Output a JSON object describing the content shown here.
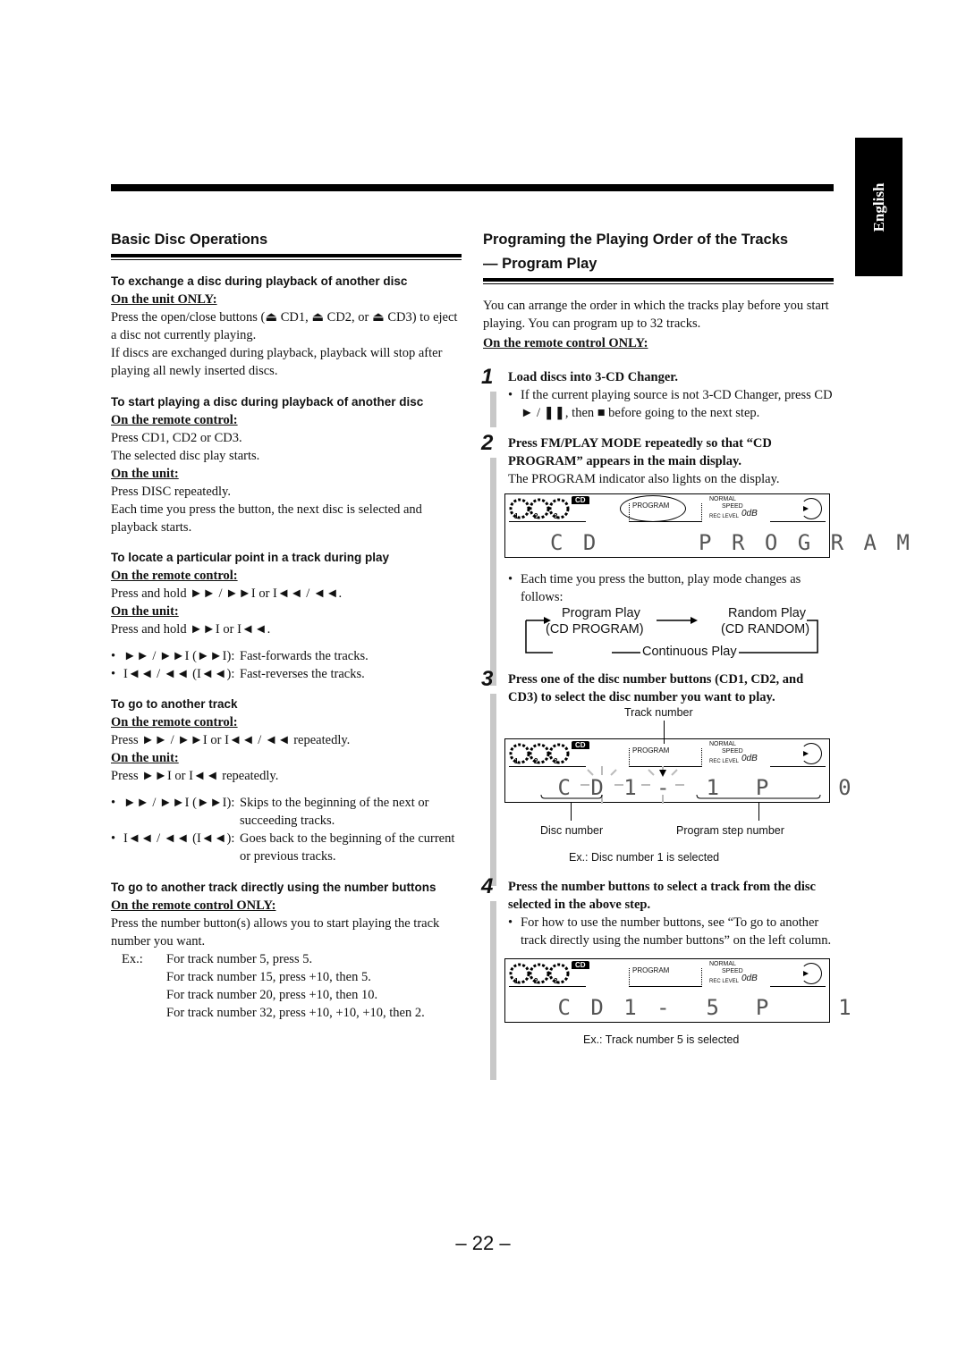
{
  "language_tab": "English",
  "page_number": "– 22 –",
  "left": {
    "title": "Basic Disc Operations",
    "exchange": {
      "heading": "To exchange a disc during playback of another disc",
      "where": "On the unit ONLY:",
      "p1": "Press the open/close buttons (⏏ CD1, ⏏ CD2, or ⏏ CD3) to eject a disc not currently playing.",
      "p2": "If discs are exchanged during playback, playback will stop after playing all newly inserted discs."
    },
    "start": {
      "heading": "To start playing a disc during playback of another disc",
      "remote_label": "On the remote control:",
      "remote_l1": "Press CD1, CD2 or CD3.",
      "remote_l2": "The selected disc play starts.",
      "unit_label": "On the unit:",
      "unit_l1": "Press DISC repeatedly.",
      "unit_l2": "Each time you press the button, the next disc is selected and playback starts."
    },
    "locate": {
      "heading": "To locate a particular point in a track during play",
      "remote_label": "On the remote control:",
      "remote_l1": "Press and hold ►► / ►►I or I◄◄ / ◄◄.",
      "unit_label": "On the unit:",
      "unit_l1": "Press and hold ►►I or I◄◄.",
      "bullets": [
        {
          "label": "►► / ►►I (►►I):",
          "text": "Fast-forwards the tracks."
        },
        {
          "label": "I◄◄ / ◄◄ (I◄◄):",
          "text": "Fast-reverses the tracks."
        }
      ]
    },
    "another": {
      "heading": "To go to another track",
      "remote_label": "On the remote control:",
      "remote_l1": "Press ►► / ►►I or I◄◄ / ◄◄ repeatedly.",
      "unit_label": "On the unit:",
      "unit_l1": "Press ►►I or I◄◄ repeatedly.",
      "bullets": [
        {
          "label": "►► / ►►I (►►I):",
          "text": "Skips to the beginning of the next or succeeding tracks."
        },
        {
          "label": "I◄◄ / ◄◄ (I◄◄):",
          "text": "Goes back to the beginning of the current or previous tracks."
        }
      ]
    },
    "direct": {
      "heading": "To go to another track directly using the number buttons",
      "where": "On the remote control ONLY:",
      "p1": "Press the number button(s) allows you to start playing the track number you want.",
      "ex_label": "Ex.:",
      "examples": [
        "For track number 5, press 5.",
        "For track number 15, press +10, then 5.",
        "For track number 20, press +10, then 10.",
        "For track number 32, press +10, +10, +10, then 2."
      ]
    }
  },
  "right": {
    "title_l1": "Programing the Playing Order of the Tracks",
    "title_l2": "— Program Play",
    "intro": "You can arrange the order in which the tracks play before you start playing. You can program up to 32 tracks.",
    "where": "On the remote control ONLY:",
    "steps": [
      {
        "num": "1",
        "title": "Load discs into 3-CD Changer.",
        "bullet": "If the current playing source is not 3-CD Changer, press CD ► / ❚❚, then ■ before going to the next step."
      },
      {
        "num": "2",
        "title": "Press FM/PLAY MODE repeatedly so that “CD PROGRAM” appears in the main display.",
        "body": "The PROGRAM indicator also lights on the display.",
        "bullet": "Each time you press the button, play mode changes as follows:",
        "mode_cycle": {
          "program_play": "Program Play",
          "program_sub": "(CD PROGRAM)",
          "random_play": "Random Play",
          "random_sub": "(CD RANDOM)",
          "continuous": "Continuous Play"
        }
      },
      {
        "num": "3",
        "title": "Press one of the disc number buttons (CD1, CD2, and CD3) to select the disc number you want to play.",
        "track_label": "Track number",
        "disc_label": "Disc number",
        "step_label": "Program step number",
        "caption": "Ex.: Disc number 1 is selected"
      },
      {
        "num": "4",
        "title": "Press the number buttons to select a track from the disc selected in the above step.",
        "bullet": "For how to use the number buttons, see “To go to another track directly using the number buttons” on the left column.",
        "caption": "Ex.: Track number 5 is selected"
      }
    ],
    "lcd": {
      "cd_badge": "CD",
      "disc_digits": "1 2 3",
      "program": "PROGRAM",
      "normal": "NORMAL",
      "speed": "SPEED",
      "rec_level": "REC LEVEL",
      "db": "0dB",
      "display_step2": "C D      P R O G R A M",
      "display_step3": " C D 1 -  1  P    0",
      "display_step4": " C D 1 -  5  P    1"
    }
  }
}
